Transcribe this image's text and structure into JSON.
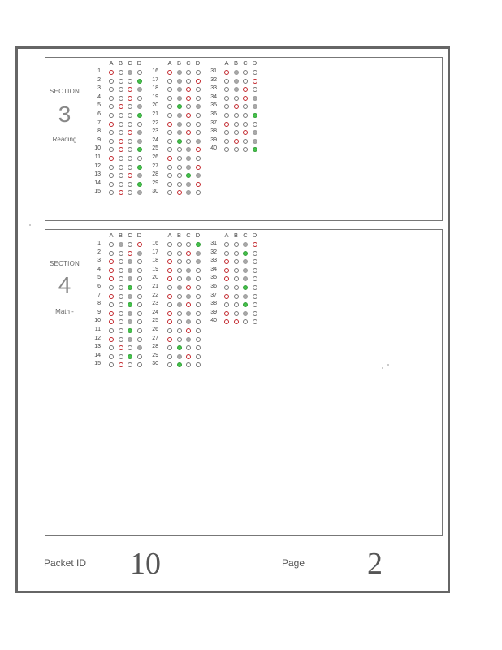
{
  "choices": [
    "A",
    "B",
    "C",
    "D"
  ],
  "sections": [
    {
      "key": "sec3",
      "label": "SECTION",
      "number": "3",
      "subject": "Reading",
      "questions": [
        {
          "n": "1",
          "m": [
            "red",
            "",
            "gray",
            ""
          ]
        },
        {
          "n": "2",
          "m": [
            "",
            "",
            "",
            "green"
          ]
        },
        {
          "n": "3",
          "m": [
            "",
            "",
            "red",
            "gray"
          ]
        },
        {
          "n": "4",
          "m": [
            "",
            "",
            "red",
            ""
          ]
        },
        {
          "n": "5",
          "m": [
            "",
            "red",
            "",
            "gray"
          ]
        },
        {
          "n": "6",
          "m": [
            "",
            "",
            "",
            "green"
          ]
        },
        {
          "n": "7",
          "m": [
            "red",
            "",
            "",
            ""
          ]
        },
        {
          "n": "8",
          "m": [
            "",
            "",
            "red",
            "gray"
          ]
        },
        {
          "n": "9",
          "m": [
            "",
            "red",
            "",
            "gray"
          ]
        },
        {
          "n": "10",
          "m": [
            "",
            "red",
            "",
            "green"
          ]
        },
        {
          "n": "11",
          "m": [
            "red",
            "",
            "",
            ""
          ]
        },
        {
          "n": "12",
          "m": [
            "",
            "",
            "",
            "green"
          ]
        },
        {
          "n": "13",
          "m": [
            "",
            "",
            "red",
            "gray"
          ]
        },
        {
          "n": "14",
          "m": [
            "",
            "",
            "",
            "green"
          ]
        },
        {
          "n": "15",
          "m": [
            "",
            "red",
            "",
            "gray"
          ]
        },
        {
          "n": "16",
          "m": [
            "red",
            "gray",
            "",
            ""
          ]
        },
        {
          "n": "17",
          "m": [
            "",
            "gray",
            "",
            "red"
          ]
        },
        {
          "n": "18",
          "m": [
            "",
            "gray",
            "red",
            ""
          ]
        },
        {
          "n": "19",
          "m": [
            "",
            "gray",
            "red",
            ""
          ]
        },
        {
          "n": "20",
          "m": [
            "",
            "green",
            "",
            "gray"
          ]
        },
        {
          "n": "21",
          "m": [
            "",
            "gray",
            "red",
            ""
          ]
        },
        {
          "n": "22",
          "m": [
            "red",
            "gray",
            "",
            ""
          ]
        },
        {
          "n": "23",
          "m": [
            "",
            "gray",
            "red",
            ""
          ]
        },
        {
          "n": "24",
          "m": [
            "",
            "green",
            "",
            "gray"
          ]
        },
        {
          "n": "25",
          "m": [
            "",
            "",
            "gray",
            "red"
          ]
        },
        {
          "n": "26",
          "m": [
            "red",
            "",
            "gray",
            ""
          ]
        },
        {
          "n": "27",
          "m": [
            "",
            "",
            "gray",
            "red"
          ]
        },
        {
          "n": "28",
          "m": [
            "",
            "",
            "green",
            "gray"
          ]
        },
        {
          "n": "29",
          "m": [
            "",
            "",
            "gray",
            "red"
          ]
        },
        {
          "n": "30",
          "m": [
            "",
            "red",
            "gray",
            ""
          ]
        },
        {
          "n": "31",
          "m": [
            "red",
            "gray",
            "",
            ""
          ]
        },
        {
          "n": "32",
          "m": [
            "",
            "gray",
            "",
            "red"
          ]
        },
        {
          "n": "33",
          "m": [
            "",
            "gray",
            "red",
            ""
          ]
        },
        {
          "n": "34",
          "m": [
            "",
            "",
            "red",
            "gray"
          ]
        },
        {
          "n": "35",
          "m": [
            "",
            "red",
            "",
            "gray"
          ]
        },
        {
          "n": "36",
          "m": [
            "",
            "",
            "",
            "green"
          ]
        },
        {
          "n": "37",
          "m": [
            "red",
            "",
            "",
            ""
          ]
        },
        {
          "n": "38",
          "m": [
            "",
            "",
            "red",
            "gray"
          ]
        },
        {
          "n": "39",
          "m": [
            "",
            "red",
            "",
            "gray"
          ]
        },
        {
          "n": "40",
          "m": [
            "",
            "",
            "",
            "green"
          ]
        }
      ]
    },
    {
      "key": "sec4",
      "label": "SECTION",
      "number": "4",
      "subject": "Math -",
      "questions": [
        {
          "n": "1",
          "m": [
            "",
            "gray",
            "",
            "red"
          ]
        },
        {
          "n": "2",
          "m": [
            "",
            "",
            "red",
            "gray"
          ]
        },
        {
          "n": "3",
          "m": [
            "red",
            "",
            "gray",
            ""
          ]
        },
        {
          "n": "4",
          "m": [
            "red",
            "",
            "gray",
            ""
          ]
        },
        {
          "n": "5",
          "m": [
            "red",
            "",
            "gray",
            ""
          ]
        },
        {
          "n": "6",
          "m": [
            "",
            "",
            "green",
            ""
          ]
        },
        {
          "n": "7",
          "m": [
            "red",
            "",
            "gray",
            ""
          ]
        },
        {
          "n": "8",
          "m": [
            "",
            "",
            "green",
            ""
          ]
        },
        {
          "n": "9",
          "m": [
            "red",
            "",
            "gray",
            ""
          ]
        },
        {
          "n": "10",
          "m": [
            "red",
            "",
            "gray",
            ""
          ]
        },
        {
          "n": "11",
          "m": [
            "",
            "",
            "green",
            ""
          ]
        },
        {
          "n": "12",
          "m": [
            "red",
            "",
            "gray",
            ""
          ]
        },
        {
          "n": "13",
          "m": [
            "",
            "red",
            "",
            "gray"
          ]
        },
        {
          "n": "14",
          "m": [
            "",
            "",
            "green",
            ""
          ]
        },
        {
          "n": "15",
          "m": [
            "",
            "red",
            "",
            ""
          ]
        },
        {
          "n": "16",
          "m": [
            "",
            "",
            "",
            "green"
          ]
        },
        {
          "n": "17",
          "m": [
            "",
            "",
            "red",
            "gray"
          ]
        },
        {
          "n": "18",
          "m": [
            "red",
            "",
            "",
            "gray"
          ]
        },
        {
          "n": "19",
          "m": [
            "red",
            "",
            "gray",
            ""
          ]
        },
        {
          "n": "20",
          "m": [
            "red",
            "",
            "gray",
            ""
          ]
        },
        {
          "n": "21",
          "m": [
            "",
            "gray",
            "red",
            ""
          ]
        },
        {
          "n": "22",
          "m": [
            "red",
            "",
            "gray",
            ""
          ]
        },
        {
          "n": "23",
          "m": [
            "",
            "gray",
            "red",
            ""
          ]
        },
        {
          "n": "24",
          "m": [
            "red",
            "",
            "gray",
            ""
          ]
        },
        {
          "n": "25",
          "m": [
            "red",
            "",
            "gray",
            ""
          ]
        },
        {
          "n": "26",
          "m": [
            "",
            "",
            "red",
            ""
          ]
        },
        {
          "n": "27",
          "m": [
            "red",
            "",
            "gray",
            ""
          ]
        },
        {
          "n": "28",
          "m": [
            "",
            "green",
            "",
            ""
          ]
        },
        {
          "n": "29",
          "m": [
            "",
            "gray",
            "red",
            ""
          ]
        },
        {
          "n": "30",
          "m": [
            "",
            "green",
            "",
            ""
          ]
        },
        {
          "n": "31",
          "m": [
            "",
            "",
            "gray",
            "red"
          ]
        },
        {
          "n": "32",
          "m": [
            "",
            "",
            "green",
            ""
          ]
        },
        {
          "n": "33",
          "m": [
            "red",
            "",
            "gray",
            ""
          ]
        },
        {
          "n": "34",
          "m": [
            "red",
            "",
            "gray",
            ""
          ]
        },
        {
          "n": "35",
          "m": [
            "red",
            "",
            "gray",
            ""
          ]
        },
        {
          "n": "36",
          "m": [
            "",
            "",
            "green",
            ""
          ]
        },
        {
          "n": "37",
          "m": [
            "red",
            "",
            "gray",
            ""
          ]
        },
        {
          "n": "38",
          "m": [
            "",
            "",
            "green",
            ""
          ]
        },
        {
          "n": "39",
          "m": [
            "red",
            "",
            "gray",
            ""
          ]
        },
        {
          "n": "40",
          "m": [
            "red",
            "red",
            "",
            ""
          ]
        }
      ]
    }
  ],
  "footer": {
    "packet_label": "Packet ID",
    "packet_id": "10",
    "page_label": "Page",
    "page_number": "2"
  }
}
